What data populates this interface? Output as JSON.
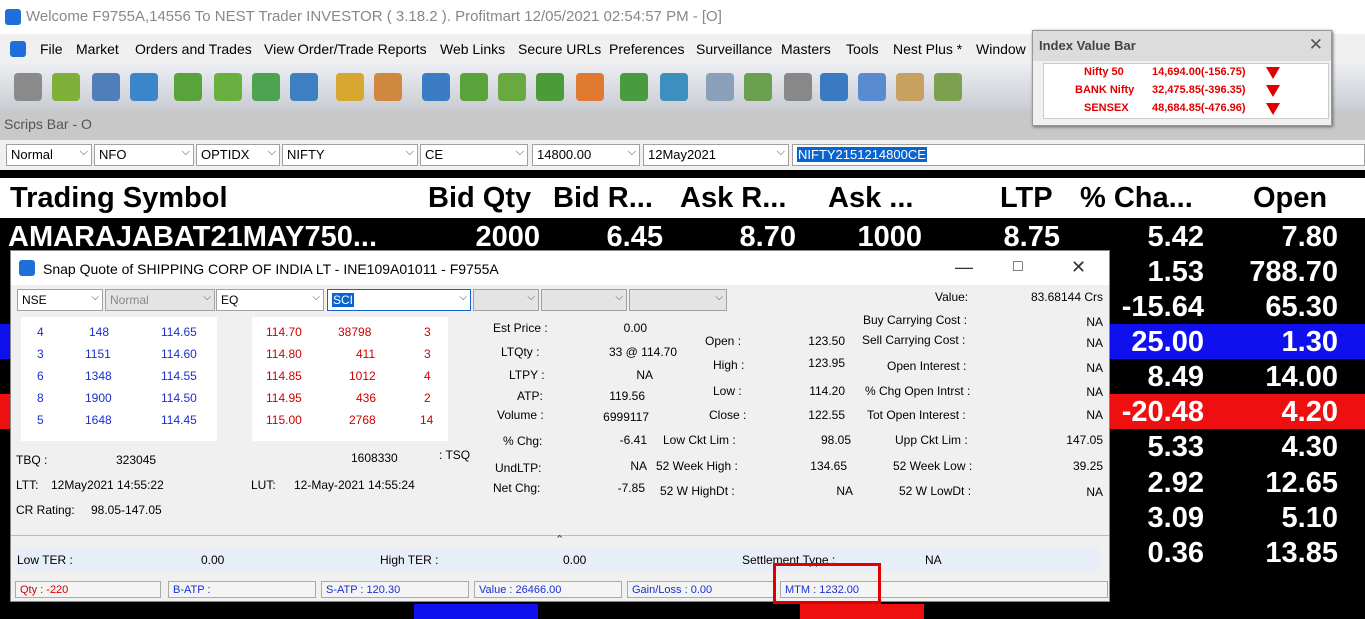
{
  "window": {
    "title": "Welcome F9755A,14556 To NEST Trader INVESTOR ( 3.18.2 ).  Profitmart  12/05/2021  02:54:57 PM - [O]"
  },
  "menu": [
    "File",
    "Market",
    "Orders and Trades",
    "View Order/Trade Reports",
    "Web Links",
    "Secure URLs",
    "Preferences",
    "Surveillance",
    "Masters",
    "Tools",
    "Nest Plus *",
    "Window"
  ],
  "scrips_bar": {
    "label": "Scrips Bar - O",
    "fields": [
      "Normal",
      "NFO",
      "OPTIDX",
      "NIFTY",
      "CE",
      "14800.00",
      "12May2021"
    ],
    "symbol": "NIFTY2151214800CE"
  },
  "index_bar": {
    "title": "Index Value Bar",
    "rows": [
      {
        "name": "Nifty 50",
        "value": "14,694.00(-156.75)"
      },
      {
        "name": "BANK Nifty",
        "value": "32,475.85(-396.35)"
      },
      {
        "name": "SENSEX",
        "value": "48,684.85(-476.96)"
      }
    ]
  },
  "grid": {
    "headers": [
      "Trading Symbol",
      "Bid Qty",
      "Bid R...",
      "Ask R...",
      "Ask ...",
      "LTP",
      "% Cha...",
      "Open"
    ],
    "row1": [
      "AMARAJABAT21MAY750...",
      "2000",
      "6.45",
      "8.70",
      "1000",
      "8.75",
      "5.42",
      "7.80"
    ],
    "right_rows": [
      {
        "pct": "1.53",
        "open": "788.70"
      },
      {
        "pct": "-15.64",
        "open": "65.30"
      },
      {
        "pct": "25.00",
        "open": "1.30"
      },
      {
        "pct": "8.49",
        "open": "14.00"
      },
      {
        "pct": "-20.48",
        "open": "4.20"
      },
      {
        "pct": "5.33",
        "open": "4.30"
      },
      {
        "pct": "2.92",
        "open": "12.65"
      },
      {
        "pct": "3.09",
        "open": "5.10"
      },
      {
        "pct": "0.36",
        "open": "13.85"
      }
    ]
  },
  "snap": {
    "title": "Snap Quote of  SHIPPING CORP OF INDIA LT - INE109A01011 - F9755A",
    "selects": [
      "NSE",
      "Normal",
      "EQ",
      "SCI"
    ],
    "bids": [
      {
        "orders": "4",
        "qty": "148",
        "price": "114.65"
      },
      {
        "orders": "3",
        "qty": "1151",
        "price": "114.60"
      },
      {
        "orders": "6",
        "qty": "1348",
        "price": "114.55"
      },
      {
        "orders": "8",
        "qty": "1900",
        "price": "114.50"
      },
      {
        "orders": "5",
        "qty": "1648",
        "price": "114.45"
      }
    ],
    "asks": [
      {
        "price": "114.70",
        "qty": "38798",
        "orders": "3"
      },
      {
        "price": "114.80",
        "qty": "411",
        "orders": "3"
      },
      {
        "price": "114.85",
        "qty": "1012",
        "orders": "4"
      },
      {
        "price": "114.95",
        "qty": "436",
        "orders": "2"
      },
      {
        "price": "115.00",
        "qty": "2768",
        "orders": "14"
      }
    ],
    "tbq_label": "TBQ :",
    "tbq": "323045",
    "tsq": "1608330",
    "tsq_label": ": TSQ",
    "ltt_label": "LTT:",
    "ltt": "12May2021 14:55:22",
    "lut_label": "LUT:",
    "lut": "12-May-2021 14:55:24",
    "cr_label": "CR Rating:",
    "cr": "98.05-147.05",
    "col1": [
      {
        "label": "Est Price :",
        "value": "0.00"
      },
      {
        "label": "LTQty :",
        "value": "33 @ 114.70"
      },
      {
        "label": "LTPY :",
        "value": "NA"
      },
      {
        "label": "ATP:",
        "value": "119.56"
      },
      {
        "label": "Volume :",
        "value": "6999117"
      },
      {
        "label": "% Chg:",
        "value": "-6.41"
      },
      {
        "label": "UndLTP:",
        "value": "NA"
      },
      {
        "label": "Net Chg:",
        "value": "-7.85"
      }
    ],
    "col2": [
      {
        "label": "Open :",
        "value": "123.50"
      },
      {
        "label": "High :",
        "value": "123.95"
      },
      {
        "label": "Low :",
        "value": "114.20"
      },
      {
        "label": "Close :",
        "value": "122.55"
      },
      {
        "label": "Low Ckt Lim :",
        "value": "98.05"
      },
      {
        "label": "52 Week High :",
        "value": "134.65"
      },
      {
        "label": "52 W HighDt :",
        "value": "NA"
      }
    ],
    "col3": [
      {
        "label": "Value:",
        "value": "83.68144 Crs"
      },
      {
        "label": "Buy Carrying Cost :",
        "value": "NA"
      },
      {
        "label": "Sell Carrying Cost :",
        "value": "NA"
      },
      {
        "label": "Open Interest :",
        "value": "NA"
      },
      {
        "label": "% Chg Open Intrst :",
        "value": "NA"
      },
      {
        "label": "Tot Open Interest :",
        "value": "NA"
      },
      {
        "label": "Upp Ckt Lim :",
        "value": "147.05"
      },
      {
        "label": "52 Week Low :",
        "value": "39.25"
      },
      {
        "label": "52 W LowDt :",
        "value": "NA"
      }
    ],
    "low_ter_label": "Low TER :",
    "low_ter": "0.00",
    "high_ter_label": "High TER :",
    "high_ter": "0.00",
    "settle_label": "Settlement Type :",
    "settle": "NA",
    "bottom": {
      "qty": "Qty : -220",
      "batp": "B-ATP :",
      "satp": "S-ATP : 120.30",
      "value": "Value : 26466.00",
      "gain": "Gain/Loss : 0.00",
      "mtm": "MTM : 1232.00"
    }
  },
  "colors": {
    "up_row": "#1010ee",
    "down_row": "#ee1010",
    "index_red": "#e00000"
  }
}
